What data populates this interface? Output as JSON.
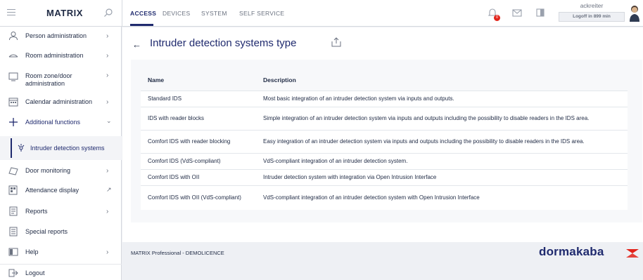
{
  "app": {
    "brand": "MATRIX"
  },
  "nav": {
    "tabs": [
      {
        "label": "ACCESS",
        "active": true
      },
      {
        "label": "DEVICES",
        "active": false
      },
      {
        "label": "SYSTEM",
        "active": false
      },
      {
        "label": "SELF SERVICE",
        "active": false
      }
    ],
    "notification_count": "0"
  },
  "user": {
    "name": "ackreiter",
    "logoff": "Logoff in 899 min"
  },
  "sidebar": {
    "items": [
      {
        "label": "Person administration",
        "icon": "person-icon"
      },
      {
        "label": "Room administration",
        "icon": "room-icon"
      },
      {
        "label": "Room zone/door administration",
        "icon": "room-zone-icon"
      },
      {
        "label": "Calendar administration",
        "icon": "calendar-icon"
      },
      {
        "label": "Additional functions",
        "icon": "plus-icon",
        "expanded": true
      },
      {
        "label": "Intruder detection systems",
        "icon": "intruder-icon",
        "sub": true
      },
      {
        "label": "Door monitoring",
        "icon": "door-icon"
      },
      {
        "label": "Attendance display",
        "icon": "attendance-icon"
      },
      {
        "label": "Reports",
        "icon": "report-icon"
      },
      {
        "label": "Special reports",
        "icon": "special-report-icon"
      },
      {
        "label": "Help",
        "icon": "help-icon"
      },
      {
        "label": "Logout",
        "icon": "logout-icon"
      }
    ]
  },
  "page": {
    "title": "Intruder detection systems type",
    "table": {
      "headers": [
        "Name",
        "Description"
      ],
      "rows": [
        {
          "name": "Standard IDS",
          "description": "Most basic integration of an intruder detection system via inputs and outputs."
        },
        {
          "name": "IDS with reader blocks",
          "description": "Simple integration of an intruder detection system via inputs and outputs including the possibility to disable readers in the IDS area."
        },
        {
          "name": "Comfort IDS with reader blocking",
          "description": "Easy integration of an intruder detection system via inputs and outputs including the possibility to disable readers in the IDS area."
        },
        {
          "name": "Comfort IDS (VdS-compliant)",
          "description": "VdS-compliant integration of an intruder detection system."
        },
        {
          "name": "Comfort IDS with OII",
          "description": "Intruder detection system with integration via Open Intrusion Interface"
        },
        {
          "name": "Comfort IDS with OII (VdS-compliant)",
          "description": "VdS-compliant integration of an intruder detection system with Open Intrusion Interface"
        }
      ]
    }
  },
  "footer": {
    "text": "MATRIX Professional - DEMOLICENCE",
    "logo": "dormakaba"
  },
  "colors": {
    "accent": "#1f2a6e",
    "brand_red": "#e2231a"
  }
}
